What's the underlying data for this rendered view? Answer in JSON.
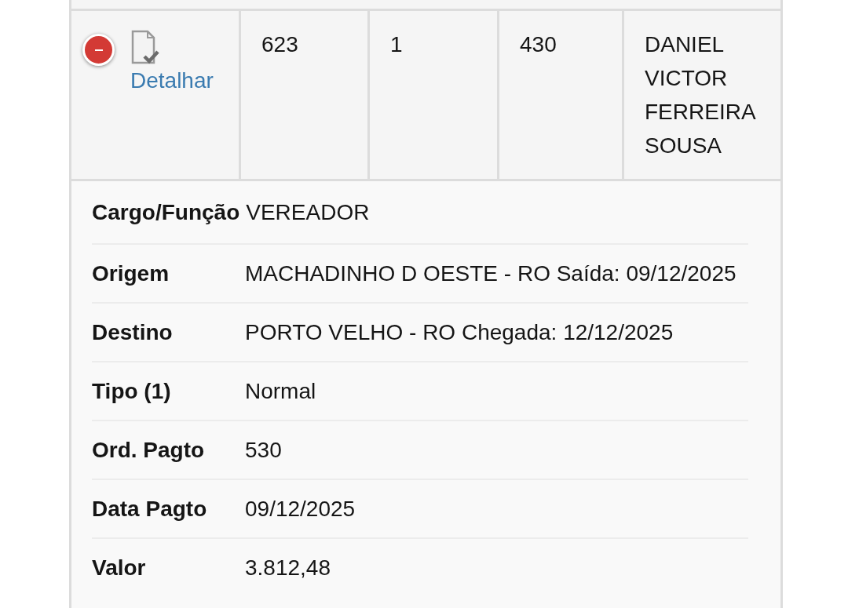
{
  "table": {
    "rows": [
      {
        "expanded": true,
        "link": "Detalhar",
        "cells": [
          "623",
          "1",
          "430",
          "DANIEL VICTOR FERREIRA SOUSA"
        ]
      }
    ]
  },
  "details": [
    {
      "kind": "inline",
      "label": "Cargo/Função",
      "value": "VEREADOR"
    },
    {
      "kind": "pair",
      "label": "Origem",
      "value": "MACHADINHO D OESTE - RO Saída: 09/12/2025"
    },
    {
      "kind": "pair",
      "label": "Destino",
      "value": "PORTO VELHO - RO Chegada: 12/12/2025"
    },
    {
      "kind": "pair",
      "label": "Tipo (1)",
      "value": "Normal"
    },
    {
      "kind": "pair",
      "label": "Ord. Pagto",
      "value": "530"
    },
    {
      "kind": "pair",
      "label": "Data Pagto",
      "value": "09/12/2025"
    },
    {
      "kind": "pair",
      "label": "Valor",
      "value": "3.812,48"
    }
  ]
}
